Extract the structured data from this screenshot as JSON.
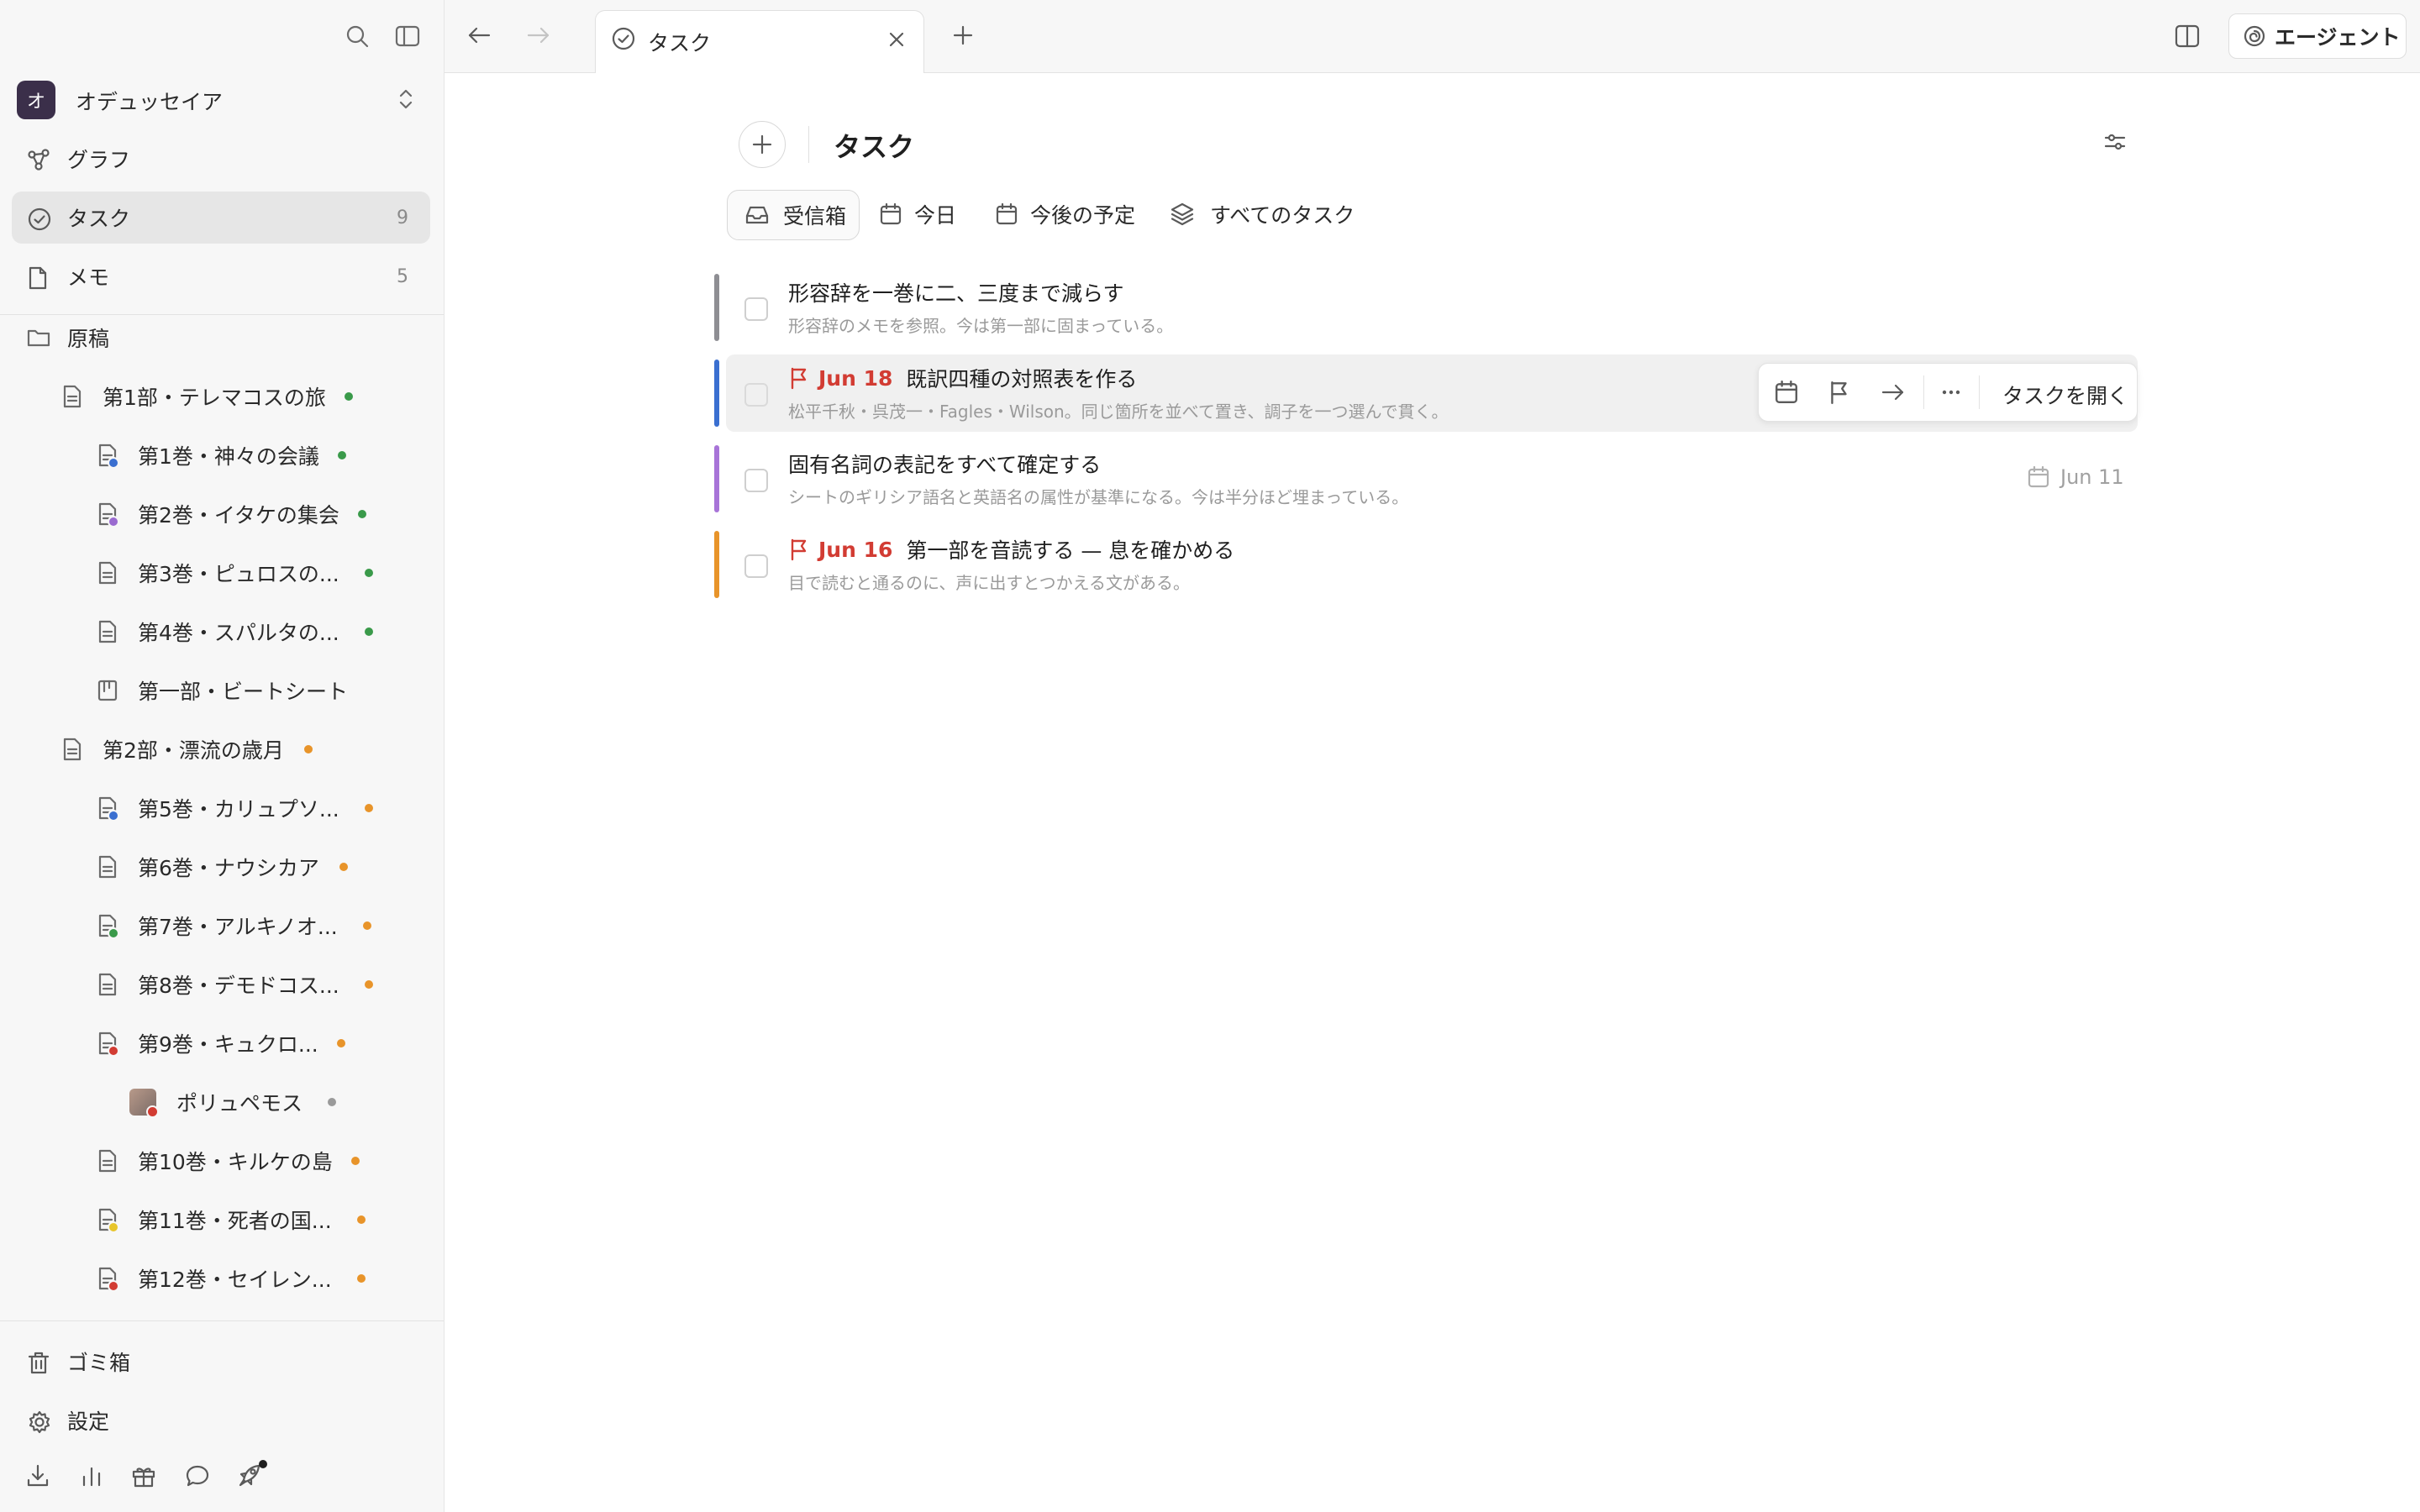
{
  "sidebar": {
    "workspace": {
      "initial": "オ",
      "name": "オデュッセイア"
    },
    "nav": [
      {
        "label": "グラフ",
        "count": ""
      },
      {
        "label": "タスク",
        "count": "9"
      },
      {
        "label": "メモ",
        "count": "5"
      }
    ],
    "folder": "原稿",
    "tree": [
      {
        "label": "第1部・テレマコスの旅",
        "dot": "#3a9a4a"
      },
      {
        "label": "第1巻・神々の会議",
        "dot": "#3a9a4a",
        "sub": "#3a6fd0"
      },
      {
        "label": "第2巻・イタケの集会",
        "dot": "#3a9a4a",
        "sub": "#9a6bd0"
      },
      {
        "label": "第3巻・ピュロスの...",
        "dot": "#3a9a4a"
      },
      {
        "label": "第4巻・スパルタの...",
        "dot": "#3a9a4a"
      },
      {
        "label": "第一部・ビートシート"
      },
      {
        "label": "第2部・漂流の歳月",
        "dot": "#e8942a"
      },
      {
        "label": "第5巻・カリュプソ...",
        "dot": "#e8942a",
        "sub": "#3a6fd0"
      },
      {
        "label": "第6巻・ナウシカア",
        "dot": "#e8942a"
      },
      {
        "label": "第7巻・アルキノオ...",
        "dot": "#e8942a",
        "sub": "#3a9a4a"
      },
      {
        "label": "第8巻・デモドコス...",
        "dot": "#e8942a"
      },
      {
        "label": "第9巻・キュクロ...",
        "dot": "#e8942a",
        "sub": "#d23c33"
      },
      {
        "label": "ポリュペモス",
        "dot": "#9a9a9a"
      },
      {
        "label": "第10巻・キルケの島",
        "dot": "#e8942a"
      },
      {
        "label": "第11巻・死者の国...",
        "dot": "#e8942a",
        "sub": "#e8c52a"
      },
      {
        "label": "第12巻・セイレン...",
        "dot": "#e8942a",
        "sub": "#d23c33"
      }
    ],
    "bottom": [
      {
        "label": "ゴミ箱"
      },
      {
        "label": "設定"
      }
    ]
  },
  "topbar": {
    "tab_label": "タスク",
    "agent_label": "エージェント"
  },
  "main": {
    "title": "タスク",
    "filters": [
      {
        "label": "受信箱",
        "icon": "inbox-icon"
      },
      {
        "label": "今日",
        "icon": "calendar-icon"
      },
      {
        "label": "今後の予定",
        "icon": "calendar-icon"
      },
      {
        "label": "すべてのタスク",
        "icon": "layers-icon"
      }
    ],
    "tasks": [
      {
        "title": "形容辞を一巻に二、三度まで減らす",
        "desc": "形容辞のメモを参照。今は第一部に固まっている。",
        "date": "",
        "flag": false,
        "due": "",
        "accent": "#8e8e93"
      },
      {
        "title": "既訳四種の対照表を作る",
        "desc": "松平千秋・呉茂一・Fagles・Wilson。同じ箇所を並べて置き、調子を一つ選んで貫く。",
        "date": "Jun 18",
        "flag": true,
        "due": "",
        "accent": "#3a6fd0"
      },
      {
        "title": "固有名詞の表記をすべて確定する",
        "desc": "シートのギリシア語名と英語名の属性が基準になる。今は半分ほど埋まっている。",
        "date": "",
        "flag": false,
        "due": "Jun 11",
        "accent": "#a874d8"
      },
      {
        "title": "第一部を音読する — 息を確かめる",
        "desc": "目で読むと通るのに、声に出すとつかえる文がある。",
        "date": "Jun 16",
        "flag": true,
        "due": "",
        "accent": "#e8942a"
      }
    ],
    "hover_toolbar": {
      "open_label": "タスクを開く"
    },
    "colors": {
      "flag": "#d23c33",
      "accent_dark": "#3b2f4a"
    }
  }
}
